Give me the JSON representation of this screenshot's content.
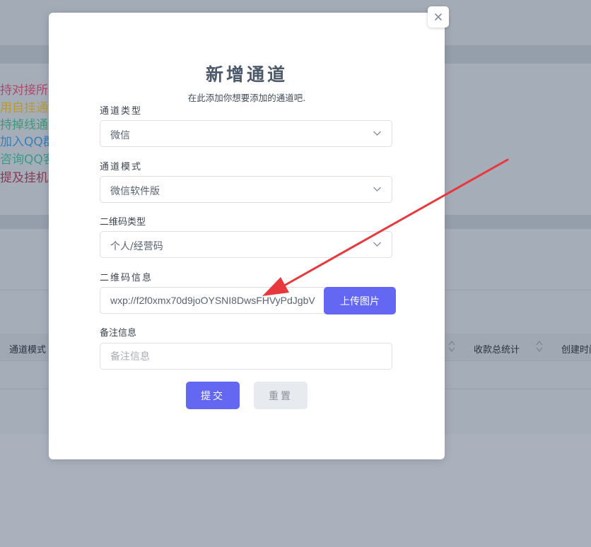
{
  "background": {
    "notices": [
      {
        "text": "持对接所有",
        "color": "#b0486a"
      },
      {
        "text": "用自挂通道",
        "color": "#b79a35"
      },
      {
        "text": "持掉线通知",
        "color": "#3d9a78"
      },
      {
        "text": "加入QQ群",
        "color": "#3a7fb8"
      },
      {
        "text": "咨询QQ客",
        "color": "#3a9a8a"
      },
      {
        "text": "提及挂机软",
        "color": "#8a3a52"
      }
    ],
    "table_headers": {
      "mode": "通道模式",
      "total": "收款总统计",
      "created": "创建时间"
    }
  },
  "modal": {
    "close_symbol": "✕",
    "title": "新增通道",
    "subtitle": "在此添加你想要添加的通道吧.",
    "fields": {
      "channel_type": {
        "label": "通道类型",
        "value": "微信"
      },
      "channel_mode": {
        "label": "通道模式",
        "value": "微信软件版"
      },
      "qr_type": {
        "label": "二维码类型",
        "value": "个人/经营码"
      },
      "qr_info": {
        "label": "二维码信息",
        "value": "wxp://f2f0xmx70d9joOYSNI8DwsFHVyPdJgbV",
        "upload_label": "上传图片"
      },
      "remark": {
        "label": "备注信息",
        "placeholder": "备注信息"
      }
    },
    "buttons": {
      "submit": "提交",
      "reset": "重置"
    }
  },
  "annotation": {
    "arrow_color": "#e8383d"
  },
  "colors": {
    "primary": "#6467f2",
    "overlay": "#aab1bd"
  }
}
